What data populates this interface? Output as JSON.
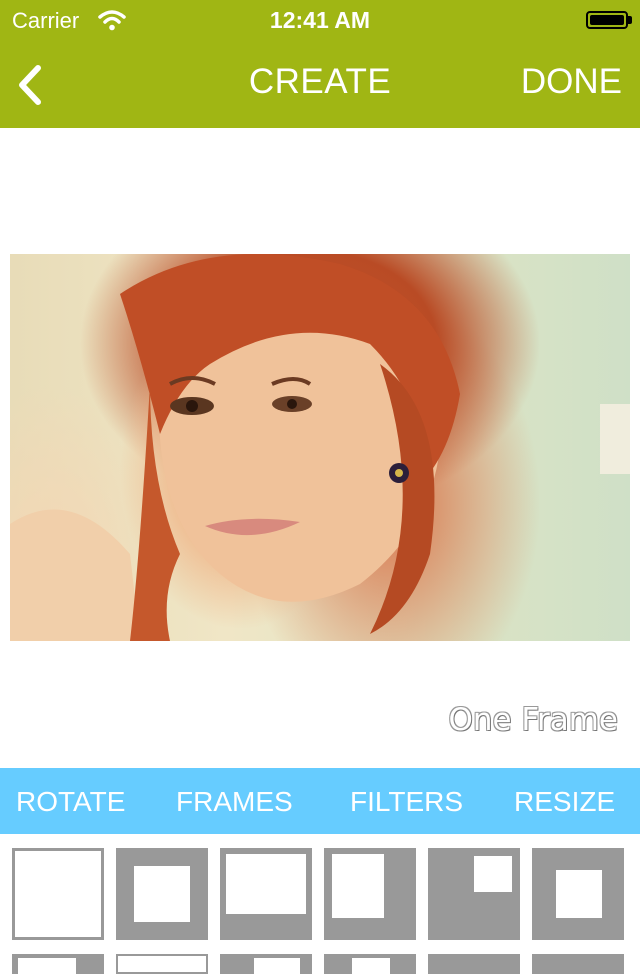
{
  "status_bar": {
    "carrier": "Carrier",
    "time": "12:41 AM"
  },
  "nav": {
    "title": "CREATE",
    "done_label": "DONE",
    "back_icon": "chevron-left-icon"
  },
  "photo": {
    "description_icon": "photo"
  },
  "caption": "One Frame",
  "toolbar": {
    "rotate": "ROTATE",
    "frames": "FRAMES",
    "filters": "FILTERS",
    "resize": "RESIZE"
  },
  "colors": {
    "nav_bg": "#a0b614",
    "toolbar_bg": "#66ccff",
    "thumb_bg": "#999999"
  },
  "frame_options": [
    "one-frame",
    "frame-2",
    "frame-3",
    "frame-4",
    "frame-5",
    "frame-6"
  ]
}
